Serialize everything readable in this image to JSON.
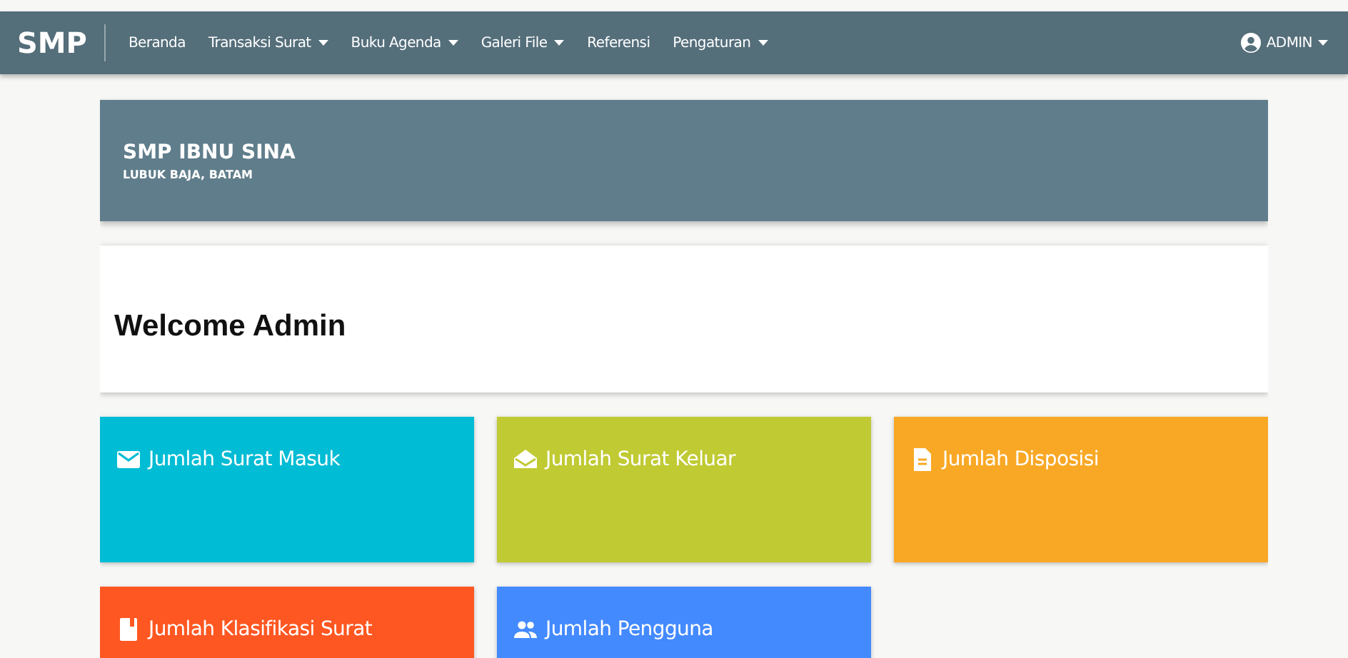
{
  "navbar": {
    "brand": "SMP",
    "menu": [
      {
        "label": "Beranda",
        "dropdown": false
      },
      {
        "label": "Transaksi Surat",
        "dropdown": true
      },
      {
        "label": "Buku Agenda",
        "dropdown": true
      },
      {
        "label": "Galeri File",
        "dropdown": true
      },
      {
        "label": "Referensi",
        "dropdown": false
      },
      {
        "label": "Pengaturan",
        "dropdown": true
      }
    ],
    "user": {
      "label": "ADMIN",
      "dropdown": true
    }
  },
  "header": {
    "title": "SMP IBNU SINA",
    "subtitle": "LUBUK BAJA, BATAM"
  },
  "welcome": "Welcome Admin",
  "cards": [
    {
      "label": "Jumlah Surat Masuk",
      "kind": "envelope",
      "color": "#00bcd4"
    },
    {
      "label": "Jumlah Surat Keluar",
      "kind": "open-envelope",
      "color": "#c0ca33"
    },
    {
      "label": "Jumlah Disposisi",
      "kind": "document",
      "color": "#f9a825"
    },
    {
      "label": "Jumlah Klasifikasi Surat",
      "kind": "book",
      "color": "#ff5722"
    },
    {
      "label": "Jumlah Pengguna",
      "kind": "people",
      "color": "#448aff"
    }
  ]
}
